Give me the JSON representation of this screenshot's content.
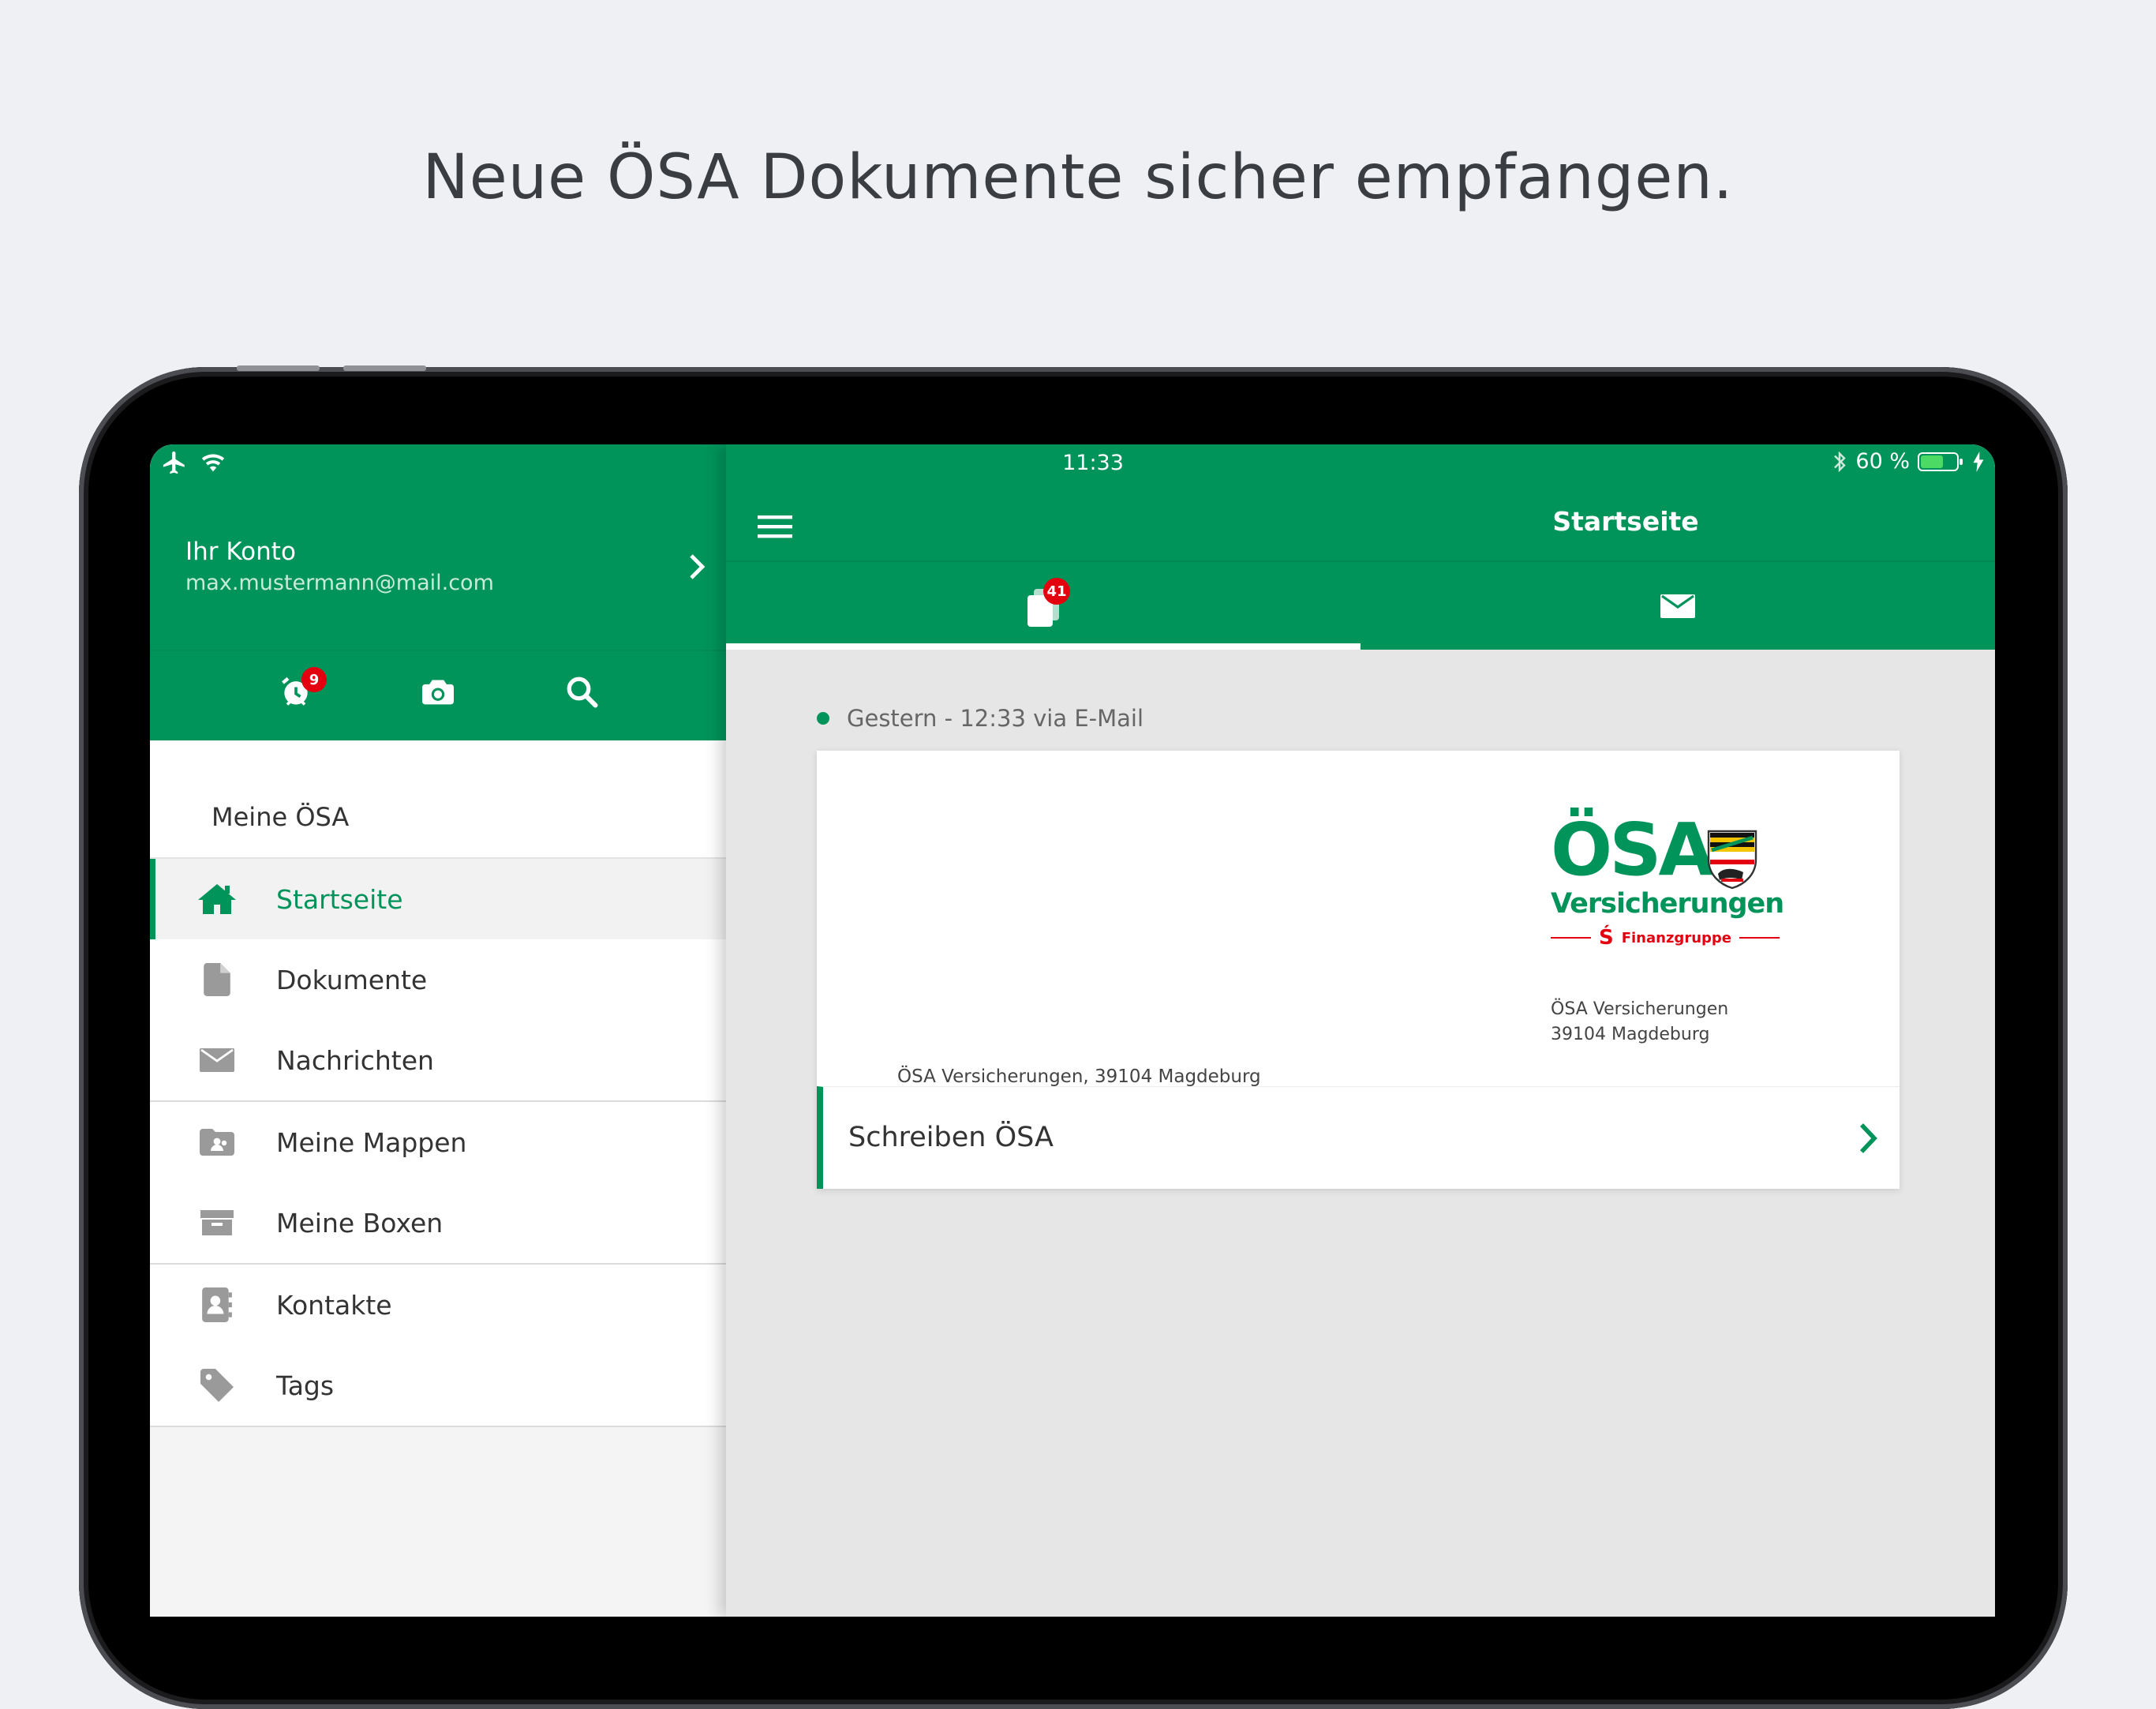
{
  "headline": "Neue ÖSA Dokumente sicher empfangen.",
  "statusbar": {
    "time": "11:33",
    "battery": "60 %"
  },
  "account": {
    "title": "Ihr Konto",
    "email": "max.mustermann@mail.com"
  },
  "drawer_toolbar": {
    "alarm_badge": "9"
  },
  "menu": {
    "section": "Meine ÖSA",
    "items": [
      {
        "label": "Startseite",
        "icon": "home-icon"
      },
      {
        "label": "Dokumente",
        "icon": "document-icon"
      },
      {
        "label": "Nachrichten",
        "icon": "envelope-icon"
      },
      {
        "label": "Meine Mappen",
        "icon": "shared-folder-icon"
      },
      {
        "label": "Meine Boxen",
        "icon": "archive-box-icon"
      },
      {
        "label": "Kontakte",
        "icon": "contacts-icon"
      },
      {
        "label": "Tags",
        "icon": "tag-icon"
      }
    ]
  },
  "main": {
    "title": "Startseite",
    "tabs": {
      "documents_badge": "41"
    },
    "feed": {
      "date": "Gestern - 12:33 via E-Mail",
      "card": {
        "logo_main": "ÖSA",
        "logo_sub": "Versicherungen",
        "logo_fin": "Finanzgruppe",
        "sender_line1": "ÖSA Versicherungen",
        "sender_line2": "39104 Magdeburg",
        "return_address": "ÖSA Versicherungen, 39104 Magdeburg",
        "title": "Schreiben ÖSA"
      }
    }
  },
  "colors": {
    "brand": "#00935a",
    "badge": "#e3000f"
  }
}
